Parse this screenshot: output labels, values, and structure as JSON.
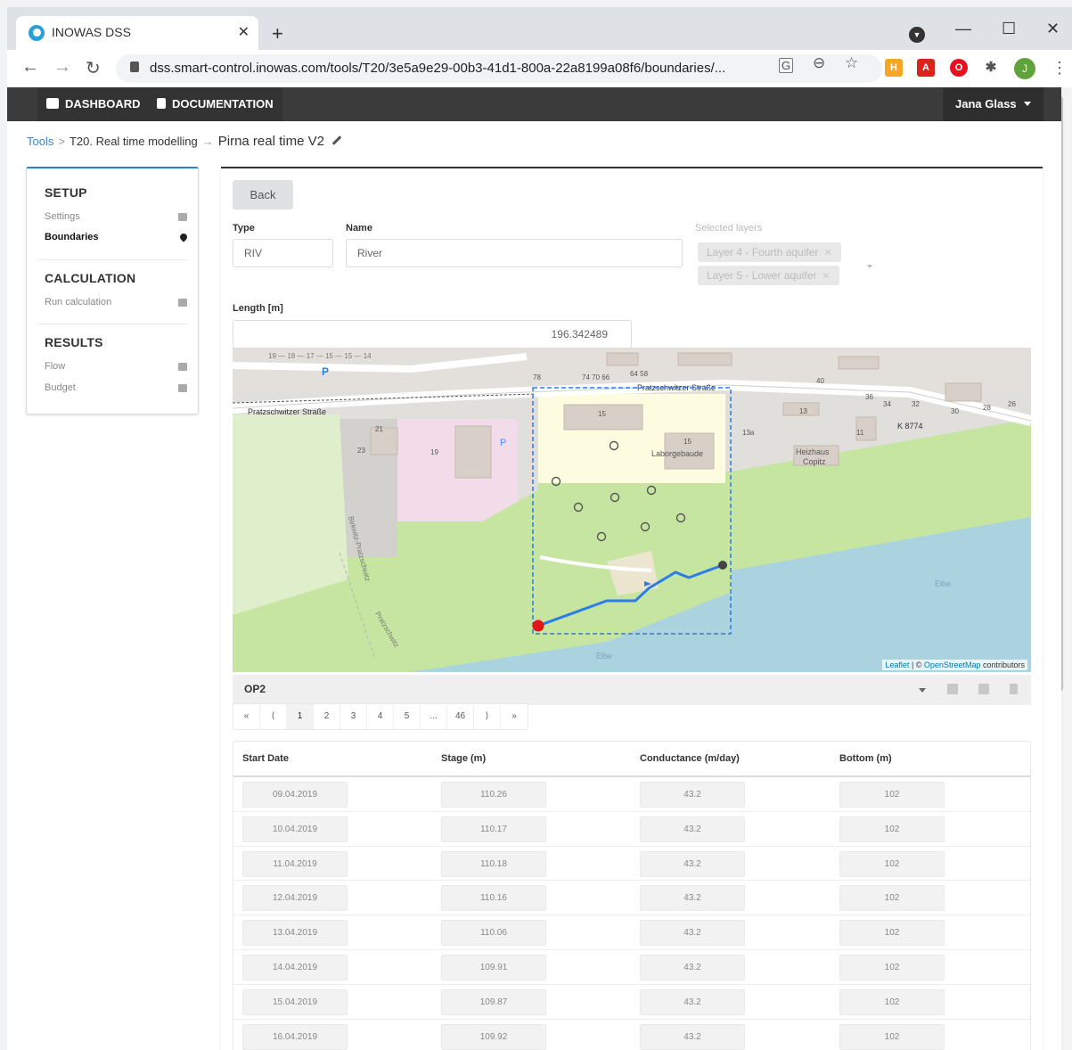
{
  "browser": {
    "tab_title": "INOWAS DSS",
    "tab_close": "✕",
    "new_tab": "+",
    "url": "dss.smart-control.inowas.com/tools/T20/3e5a9e29-00b3-41d1-800a-22a8199a08f6/boundaries/...",
    "window_minimize": "—",
    "window_maximize": "☐",
    "window_close": "✕",
    "profile_initial": "J"
  },
  "nav": {
    "dashboard": "DASHBOARD",
    "documentation": "DOCUMENTATION",
    "user": "Jana Glass"
  },
  "breadcrumb": {
    "tools": "Tools",
    "tool": "T20. Real time modelling",
    "current": "Pirna real time V2"
  },
  "sidebar": {
    "setup": "SETUP",
    "settings": "Settings",
    "boundaries": "Boundaries",
    "calculation": "CALCULATION",
    "run_calculation": "Run calculation",
    "results": "RESULTS",
    "flow": "Flow",
    "budget": "Budget"
  },
  "form": {
    "back": "Back",
    "type_label": "Type",
    "type_value": "RIV",
    "name_label": "Name",
    "name_value": "River",
    "layers_label": "Selected layers",
    "layers": [
      "Layer 4 - Fourth aquifer",
      "Layer 5 - Lower aquifer"
    ],
    "length_label": "Length [m]",
    "length_value": "196.342489"
  },
  "map": {
    "labels": {
      "street1": "Pratzschwitzer Straße",
      "street2": "Pratzschwitzer Straße",
      "k8774": "K 8774",
      "laborgebaude": "Laborgebaude",
      "heizhaus1": "Heizhaus",
      "heizhaus2": "Copitz",
      "elbe1": "Elbe",
      "elbe2": "Elbe",
      "birkwitz": "Birkwitz-Pratzschwitz",
      "pratzschwitz": "Pratzschwitz",
      "num15a": "15",
      "num15b": "15",
      "num13a": "13a",
      "num13": "13",
      "num40": "40",
      "num36": "36",
      "num34": "34",
      "num32": "32",
      "num30": "30",
      "num28": "28",
      "num26": "26",
      "num11": "11",
      "num21": "21",
      "num23": "23",
      "num19": "19",
      "num78": "78",
      "numtop": "74 70 66",
      "num6458": "64 58",
      "nums_top": "19 — 18 — 17 — 15 — 15 — 14",
      "parking": "P"
    },
    "attribution_leaflet": "Leaflet",
    "attribution_sep": " | © ",
    "attribution_osm": "OpenStreetMap",
    "attribution_tail": " contributors"
  },
  "op": {
    "label": "OP2"
  },
  "pager": [
    "«",
    "⟨",
    "1",
    "2",
    "3",
    "4",
    "5",
    "...",
    "46",
    "⟩",
    "»"
  ],
  "table": {
    "headers": [
      "Start Date",
      "Stage (m)",
      "Conductance (m/day)",
      "Bottom (m)"
    ],
    "rows": [
      [
        "09.04.2019",
        "110.26",
        "43.2",
        "102"
      ],
      [
        "10.04.2019",
        "110.17",
        "43.2",
        "102"
      ],
      [
        "11.04.2019",
        "110.18",
        "43.2",
        "102"
      ],
      [
        "12.04.2019",
        "110.16",
        "43.2",
        "102"
      ],
      [
        "13.04.2019",
        "110.06",
        "43.2",
        "102"
      ],
      [
        "14.04.2019",
        "109.91",
        "43.2",
        "102"
      ],
      [
        "15.04.2019",
        "109.87",
        "43.2",
        "102"
      ],
      [
        "16.04.2019",
        "109.92",
        "43.2",
        "102"
      ]
    ]
  },
  "colors": {
    "nav_bg": "#3b3b3b",
    "river_line": "#2b7de9",
    "start_point": "#e0171b",
    "end_point": "#444444",
    "water": "#aad3df",
    "grass": "#c6e5a0"
  }
}
